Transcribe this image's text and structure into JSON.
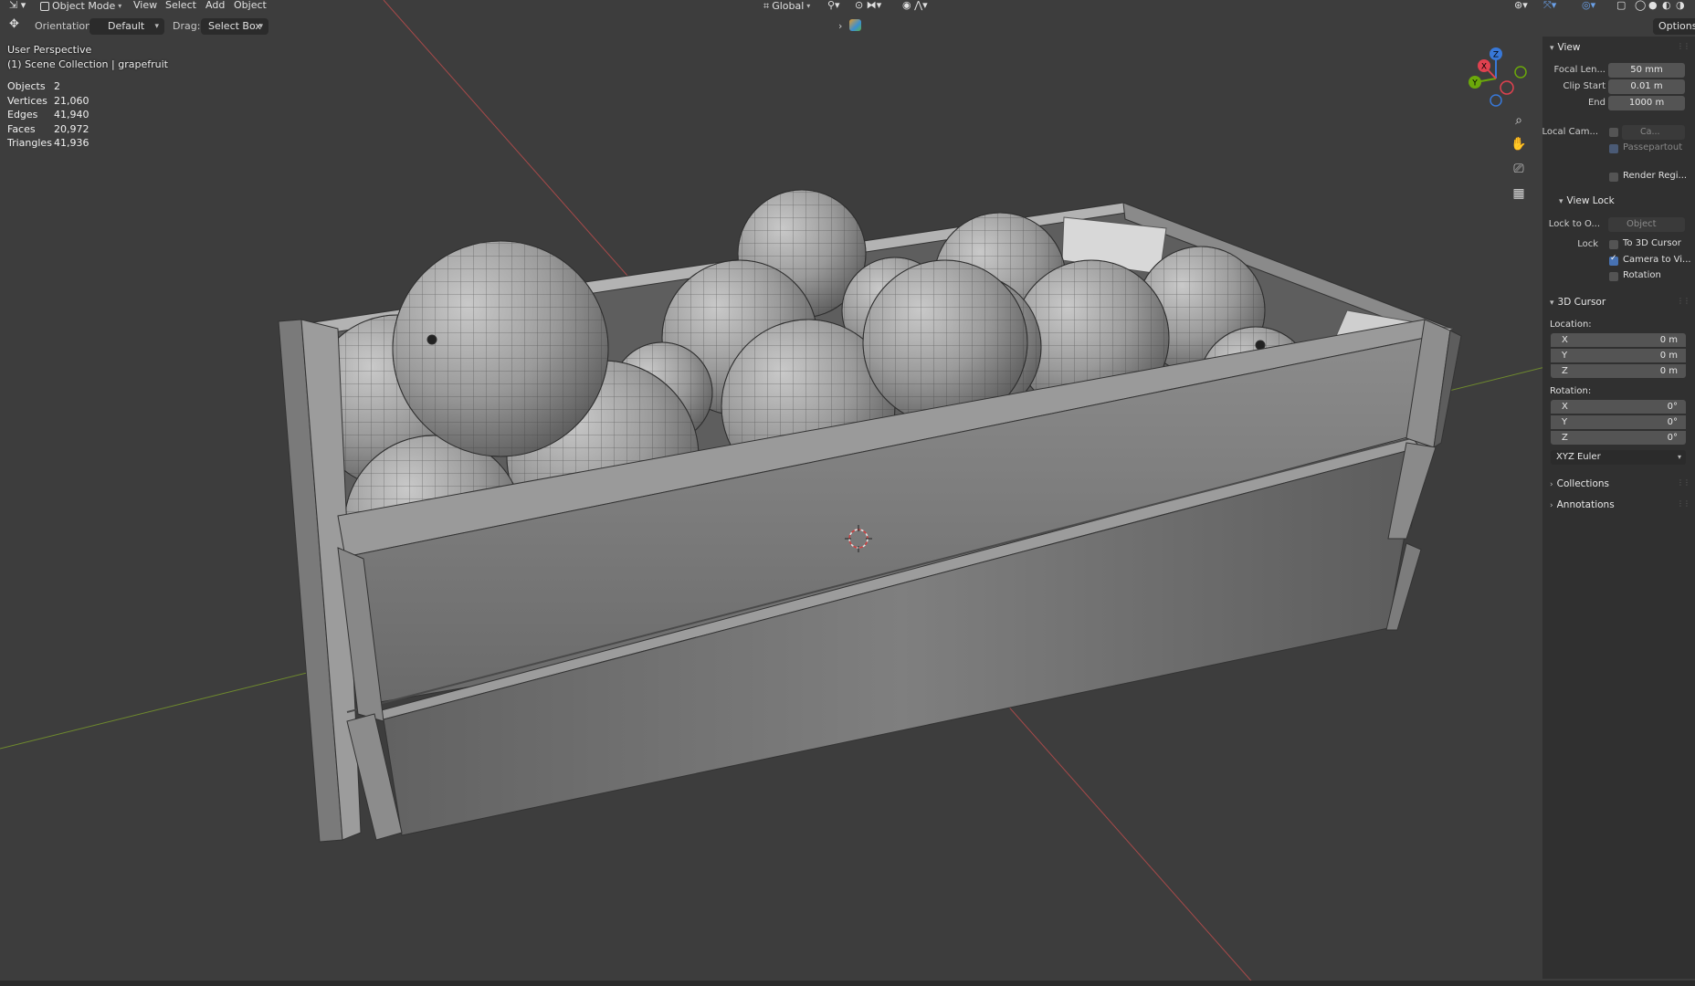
{
  "header": {
    "mode_label": "Object Mode",
    "menu": [
      "View",
      "Select",
      "Add",
      "Object"
    ],
    "transform_orientation": "Global"
  },
  "toolbar": {
    "orientation_label": "Orientation:",
    "orientation_value": "Default",
    "drag_label": "Drag:",
    "drag_value": "Select Box",
    "options_label": "Options"
  },
  "overlay": {
    "view_name": "User Perspective",
    "collection": "(1) Scene Collection | grapefruit",
    "stats": [
      {
        "label": "Objects",
        "value": "2"
      },
      {
        "label": "Vertices",
        "value": "21,060"
      },
      {
        "label": "Edges",
        "value": "41,940"
      },
      {
        "label": "Faces",
        "value": "20,972"
      },
      {
        "label": "Triangles",
        "value": "41,936"
      }
    ]
  },
  "gizmo": {
    "axes": {
      "x": "X",
      "y": "Y",
      "z": "Z"
    },
    "colors": {
      "x": "#e0414f",
      "y": "#6ba80a",
      "z": "#3878d8"
    }
  },
  "sidebar": {
    "view": {
      "title": "View",
      "focal_label": "Focal Len...",
      "focal_value": "50 mm",
      "clip_start_label": "Clip Start",
      "clip_start_value": "0.01 m",
      "end_label": "End",
      "end_value": "1000 m",
      "local_cam_label": "Local Cam...",
      "local_cam_value": "Ca...",
      "passepartout_label": "Passepartout",
      "render_region_label": "Render Regi..."
    },
    "view_lock": {
      "title": "View Lock",
      "lock_to_label": "Lock to O...",
      "lock_to_placeholder": "Object",
      "lock_label": "Lock",
      "to_3d_cursor": "To 3D Cursor",
      "camera_to_view": "Camera to Vi...",
      "rotation": "Rotation"
    },
    "cursor": {
      "title": "3D Cursor",
      "location_label": "Location:",
      "location": [
        {
          "axis": "X",
          "value": "0 m"
        },
        {
          "axis": "Y",
          "value": "0 m"
        },
        {
          "axis": "Z",
          "value": "0 m"
        }
      ],
      "rotation_label": "Rotation:",
      "rotation": [
        {
          "axis": "X",
          "value": "0°"
        },
        {
          "axis": "Y",
          "value": "0°"
        },
        {
          "axis": "Z",
          "value": "0°"
        }
      ],
      "rotation_mode": "XYZ Euler"
    },
    "collections_label": "Collections",
    "annotations_label": "Annotations"
  },
  "colors": {
    "viewport_bg": "#3d3d3d",
    "x_axis_line": "#a84a4a",
    "y_axis_line": "#6f8a2e",
    "accent": "#4772b3"
  }
}
